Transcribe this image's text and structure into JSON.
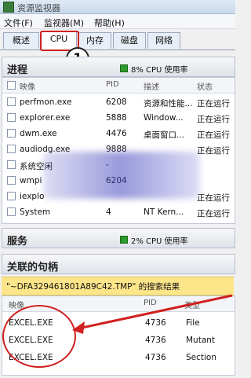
{
  "window": {
    "title": "资源监视器"
  },
  "menu": [
    "文件(F)",
    "监视器(M)",
    "帮助(H)"
  ],
  "tabs": [
    "概述",
    "CPU",
    "内存",
    "磁盘",
    "网络"
  ],
  "callout": {
    "number": "1"
  },
  "processes": {
    "title": "进程",
    "stat": "8% CPU 使用率",
    "columns": [
      "映像",
      "PID",
      "描述",
      "状态"
    ],
    "rows": [
      {
        "image": "perfmon.exe",
        "pid": "6208",
        "desc": "资源和性能...",
        "status": "正在运行"
      },
      {
        "image": "explorer.exe",
        "pid": "5888",
        "desc": "Window...",
        "status": "正在运行"
      },
      {
        "image": "dwm.exe",
        "pid": "4476",
        "desc": "桌面窗口...",
        "status": "正在运行"
      },
      {
        "image": "audiodg.exe",
        "pid": "9888",
        "desc": "",
        "status": "正在运行"
      },
      {
        "image": "系统空闲",
        "pid": "-",
        "desc": "",
        "status": ""
      },
      {
        "image": "wmpi",
        "pid": "6204",
        "desc": "",
        "status": ""
      },
      {
        "image": "iexplo",
        "pid": "",
        "desc": "",
        "status": "正在运行"
      },
      {
        "image": "System",
        "pid": "4",
        "desc": "NT Kern...",
        "status": "正在运行"
      }
    ]
  },
  "services": {
    "title": "服务",
    "stat": "2% CPU 使用率"
  },
  "handles": {
    "title": "关联的句柄",
    "search_result": "\"~DFA329461801A89C42.TMP\" 的搜索结果",
    "columns": [
      "映像",
      "PID",
      "类型"
    ],
    "rows": [
      {
        "image": "EXCEL.EXE",
        "pid": "4736",
        "type": "File"
      },
      {
        "image": "EXCEL.EXE",
        "pid": "4736",
        "type": "Mutant"
      },
      {
        "image": "EXCEL.EXE",
        "pid": "4736",
        "type": "Section"
      }
    ]
  },
  "colors": {
    "accent_green": "#2c9a2c",
    "highlight_yellow": "#fde58a",
    "annotation_red": "#d02020"
  }
}
